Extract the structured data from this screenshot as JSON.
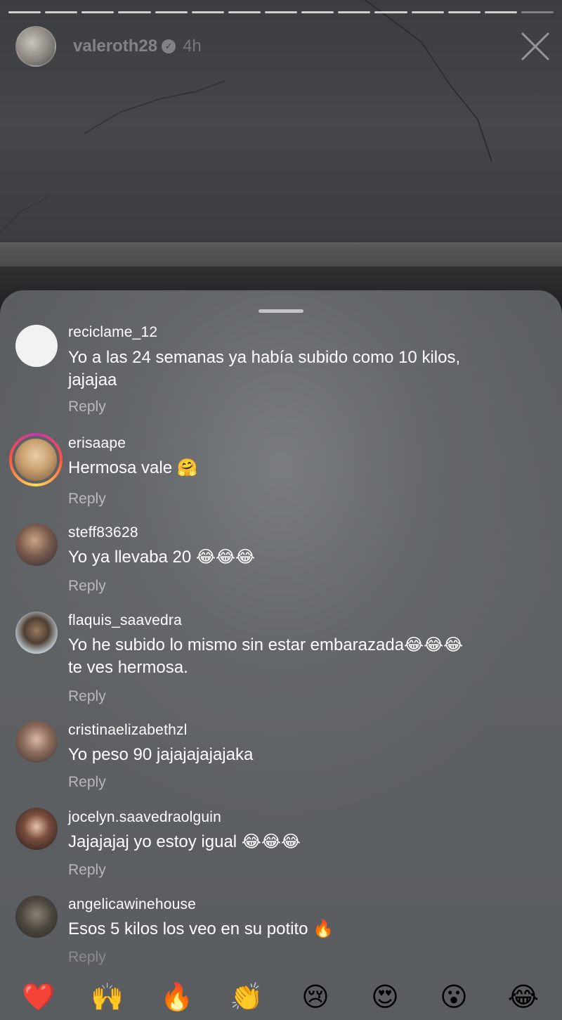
{
  "story": {
    "username": "valeroth28",
    "verified_glyph": "✓",
    "time": "4h",
    "progress_segments": 15,
    "progress_done": 14
  },
  "comments": [
    {
      "username": "reciclame_12",
      "text": "Yo a las 24 semanas ya había subido como 10 kilos, jajajaa",
      "reply": "Reply",
      "avatar": "blank-white"
    },
    {
      "username": "erisaape",
      "text": "Hermosa vale 🤗",
      "reply": "Reply",
      "avatar": "story-ring"
    },
    {
      "username": "steff83628",
      "text": "Yo ya llevaba 20 😂😂😂",
      "reply": "Reply",
      "avatar": "photo"
    },
    {
      "username": "flaquis_saavedra",
      "text": "Yo he subido lo mismo sin estar embarazada😂😂😂 te ves hermosa.",
      "reply": "Reply",
      "avatar": "photo"
    },
    {
      "username": "cristinaelizabethzl",
      "text": "Yo peso 90 jajajajajajaka",
      "reply": "Reply",
      "avatar": "photo"
    },
    {
      "username": "jocelyn.saavedraolguin",
      "text": "Jajajajaj yo estoy igual 😂😂😂",
      "reply": "Reply",
      "avatar": "photo"
    },
    {
      "username": "angelicawinehouse",
      "text": "Esos 5 kilos los veo en su potito 🔥",
      "reply": "Reply",
      "avatar": "photo"
    }
  ],
  "quick_reactions": [
    "❤️",
    "🙌",
    "🔥",
    "👏",
    "😢",
    "😍",
    "😮",
    "😂"
  ],
  "colors": {
    "sheet_bg": "#5f6265",
    "text": "#ffffff",
    "reply": "rgba(255,255,255,0.55)"
  }
}
